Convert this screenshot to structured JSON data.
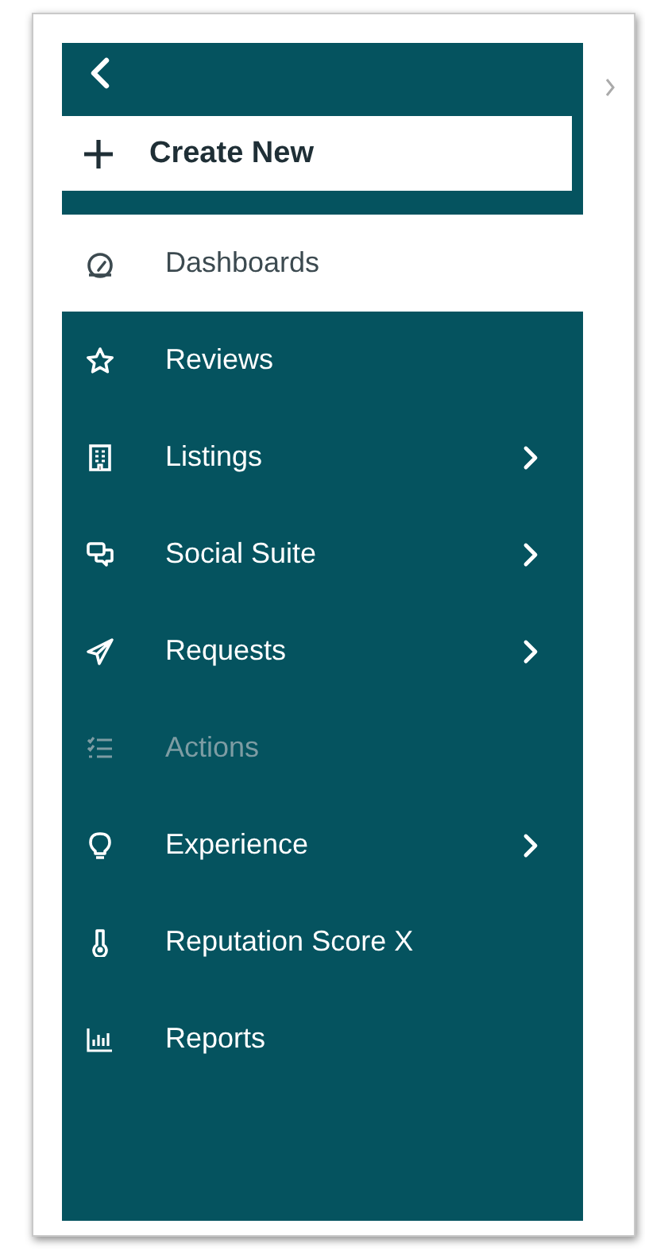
{
  "create_button": {
    "label": "Create New"
  },
  "menu": [
    {
      "label": "Dashboards",
      "selected": true,
      "disabled": false,
      "expandable": false
    },
    {
      "label": "Reviews",
      "selected": false,
      "disabled": false,
      "expandable": false
    },
    {
      "label": "Listings",
      "selected": false,
      "disabled": false,
      "expandable": true
    },
    {
      "label": "Social Suite",
      "selected": false,
      "disabled": false,
      "expandable": true
    },
    {
      "label": "Requests",
      "selected": false,
      "disabled": false,
      "expandable": true
    },
    {
      "label": "Actions",
      "selected": false,
      "disabled": true,
      "expandable": false
    },
    {
      "label": "Experience",
      "selected": false,
      "disabled": false,
      "expandable": true
    },
    {
      "label": "Reputation Score X",
      "selected": false,
      "disabled": false,
      "expandable": false
    },
    {
      "label": "Reports",
      "selected": false,
      "disabled": false,
      "expandable": false
    }
  ]
}
